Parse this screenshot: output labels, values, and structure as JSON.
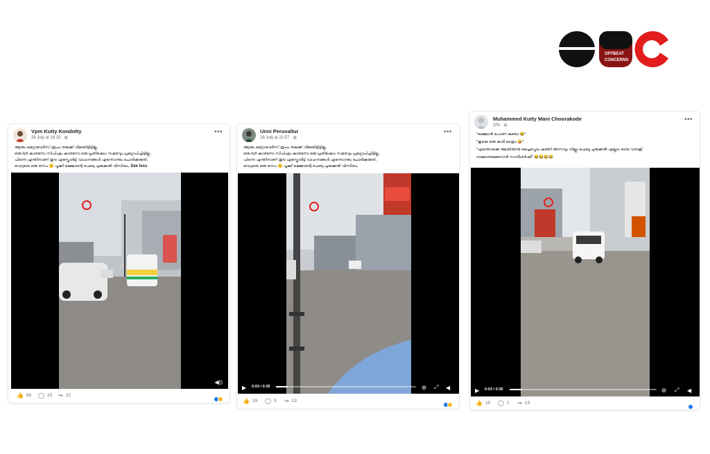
{
  "brand": {
    "logo_text_1": "OFFBEAT",
    "logo_text_2": "CONCERNS"
  },
  "posts": [
    {
      "author": "Vpm Kutty Kondotty",
      "timestamp": "28 July at 16:33 · ",
      "caption_lines": [
        "ആരും മെറ്റാവേർസ് രൂപം തലക്ക് വിലയിട്ടിട്ടില്ല,",
        "ഒരു dyfi കാരനോ സിപിഎം കാരനോ ഒരു പ്രതിഷേധ സമരവും പ്രഖ്യാപിച്ചിട്ടില്ല ,",
        "പിന്നെ എന്തിനാണ് ഈ എസ്കോർട്ട് വാഹനങ്ങൾ എന്നൊന്നും ചോദിക്കരുത്,",
        "വെറുതെ ഒരു രസം 🤫 പൂക്കി മെമ്മാന്റെ ചെബു ചുരുക്കൽ വിസിയം,"
      ],
      "see_less": "See less",
      "likes": "65",
      "comments": "15",
      "shares": "22",
      "video_time": ""
    },
    {
      "author": "Unni Peruvallur",
      "timestamp": "28 July at 22:57 · ",
      "caption_lines": [
        "ആരും മെറ്റാവേർസ് രൂപം തലക്ക് വിലയിട്ടിട്ടില്ല,",
        "ഒരു dyfi കാരനോ സിപിഎം കാരനോ ഒരു പ്രതിഷേധ സമരവും പ്രഖ്യാപിച്ചിട്ടില്ല ,",
        "പിന്നെ എന്തിനാണ് ഈ എസ്കോർട്ട് വാഹനങ്ങൾ എന്നൊന്നും ചോദിക്കരുത്,",
        "വെറുതെ ഒരു രസം 🤫 പൂക്കി മെമ്മാന്റെ ചെബു ചുരുക്കൽ വിസിയം,"
      ],
      "likes": "19",
      "comments": "3",
      "shares": "13",
      "video_time": "0:03 / 0:35",
      "progress": 0.085
    },
    {
      "author": "Muhammed Kutty Mani Choorakode",
      "timestamp": "20h · ",
      "caption_lines": [
        "*മെമ്മാൻ പോണ കണ്ടാ 😂*",
        "*തുകെ ഒരു കാർ മാത്രം 🤪*",
        "*എന്തൊക്കെ ആയിരുന്നു മെച്ചപ്പെടം കത്തി അനമ്പും വില്ലും ചെബു ചുരുക്കൽ എല്ലാം ഓയ വരാളി",
        "ദാമോദരമേനോൻ സമ്പീശർഷി* 😂😂😂😂"
      ],
      "likes": "10",
      "comments": "1",
      "shares": "13",
      "video_time": "0:03 / 0:35",
      "progress": 0.085
    }
  ],
  "icons": {
    "like": "like-icon",
    "comment": "comment-icon",
    "share": "share-icon",
    "play": "play-icon",
    "settings": "settings-icon",
    "fullscreen": "fullscreen-icon",
    "volume": "volume-icon",
    "more": "more-options-icon"
  },
  "colors": {
    "logo_red": "#e21d1d",
    "logo_black": "#111111",
    "fb_blue": "#1877f2",
    "reaction_yellow": "#f7b928"
  }
}
